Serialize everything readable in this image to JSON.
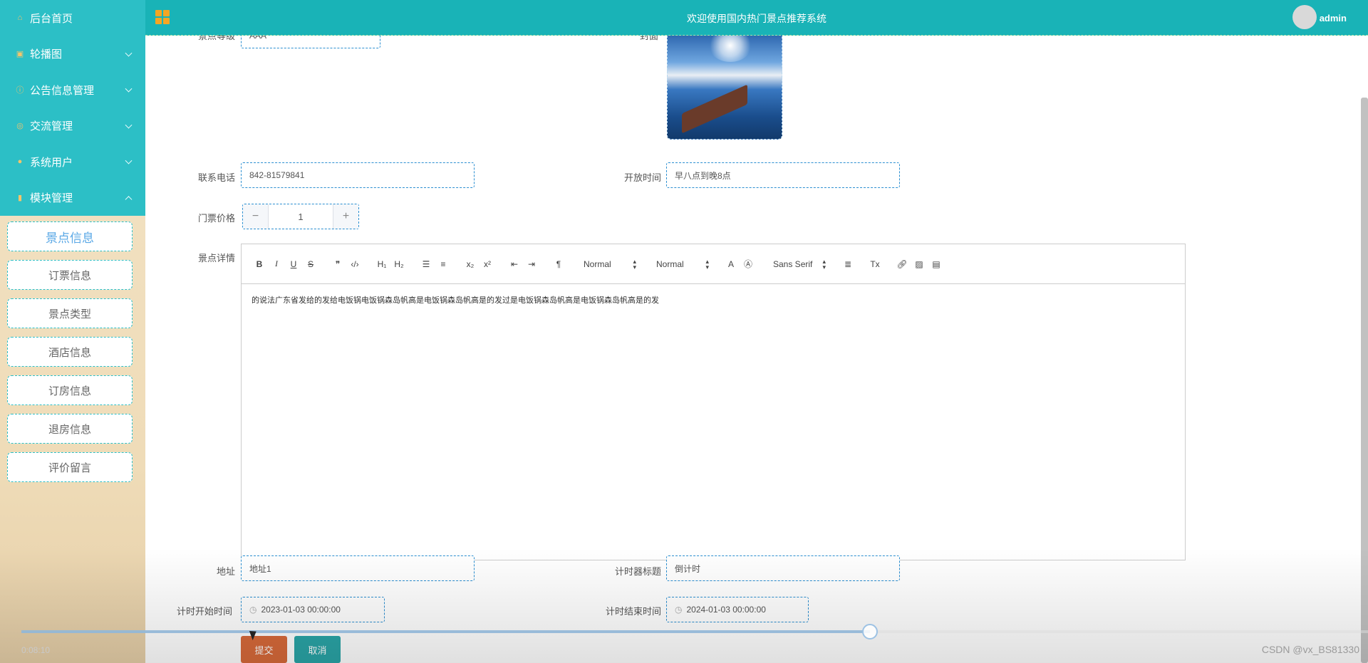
{
  "sidebar": {
    "items": [
      {
        "label": "后台首页",
        "icon": "home-icon"
      },
      {
        "label": "轮播图",
        "icon": "image-icon"
      },
      {
        "label": "公告信息管理",
        "icon": "info-icon"
      },
      {
        "label": "交流管理",
        "icon": "chat-icon"
      },
      {
        "label": "系统用户",
        "icon": "user-icon"
      },
      {
        "label": "模块管理",
        "icon": "module-icon"
      }
    ],
    "submenu": [
      "景点信息",
      "订票信息",
      "景点类型",
      "酒店信息",
      "订房信息",
      "退房信息",
      "评价留言"
    ]
  },
  "header": {
    "title": "欢迎使用国内热门景点推荐系统",
    "user": "admin"
  },
  "form": {
    "level_label": "景点等级",
    "level_value": "AAA",
    "cover_label": "封面",
    "phone_label": "联系电话",
    "phone_value": "842-81579841",
    "open_label": "开放时间",
    "open_value": "早八点到晚8点",
    "price_label": "门票价格",
    "price_value": "1",
    "detail_label": "景点详情",
    "detail_content": "的说法广东省发给的发给电饭锅电饭锅森岛帆高是电饭锅森岛帆高是的发过是电饭锅森岛帆高是电饭锅森岛帆高是的发",
    "address_label": "地址",
    "address_value": "地址1",
    "timer_title_label": "计时器标题",
    "timer_title_value": "倒计时",
    "start_label": "计时开始时间",
    "start_value": "2023-01-03 00:00:00",
    "end_label": "计时结束时间",
    "end_value": "2024-01-03 00:00:00",
    "submit": "提交",
    "cancel": "取消"
  },
  "editor": {
    "header_picker": "Normal",
    "size_picker": "Normal",
    "font_picker": "Sans Serif"
  },
  "video": {
    "time": "0:08:10",
    "progress": 0.63
  },
  "watermark": "CSDN @vx_BS81330",
  "colors": {
    "sidebar_menu": "#2cbfc6",
    "header": "#19b3b7",
    "submit": "#d86a3a",
    "cancel": "#2aa5a7"
  }
}
